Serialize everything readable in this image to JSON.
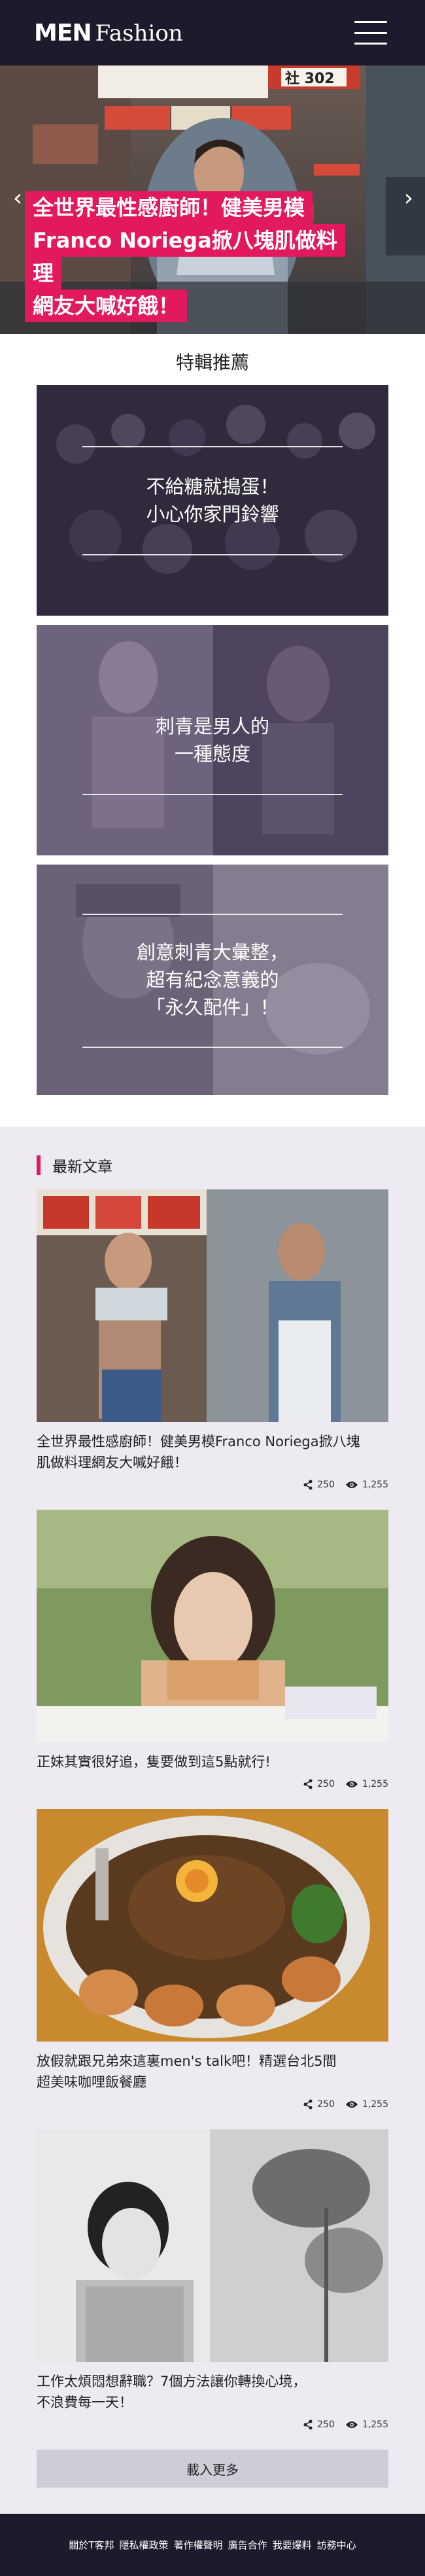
{
  "header": {
    "logo_men": "MEN",
    "logo_fashion": "Fashion",
    "menu_icon": "hamburger-menu-icon"
  },
  "hero": {
    "caption_lines": [
      "全世界最性感廚師！健美男模",
      "Franco Noriega掀八塊肌做料理",
      "網友大喊好餓！"
    ],
    "sign_text": "社 302",
    "prev_icon": "chevron-left-icon",
    "next_icon": "chevron-right-icon"
  },
  "featured": {
    "title": "特輯推薦",
    "items": [
      {
        "text": "不給糖就搗蛋！\n小心你家門鈴響"
      },
      {
        "text": "刺青是男人的\n一種態度"
      },
      {
        "text": "創意刺青大彙整，\n超有紀念意義的\n「永久配件」！"
      }
    ]
  },
  "latest": {
    "title": "最新文章",
    "articles": [
      {
        "title": "全世界最性感廚師！健美男模Franco Noriega掀八塊\n肌做料理網友大喊好餓！",
        "shares": "250",
        "views": "1,255"
      },
      {
        "title": "正妹其實很好追，隻要做到這5點就行!",
        "shares": "250",
        "views": "1,255"
      },
      {
        "title": "放假就跟兄弟來這裏men's talk吧！精選台北5間\n超美味咖哩飯餐廳",
        "shares": "250",
        "views": "1,255"
      },
      {
        "title": "工作太煩悶想辭職？7個方法讓你轉換心境，\n不浪費每一天！",
        "shares": "250",
        "views": "1,255"
      }
    ],
    "load_more": "載入更多"
  },
  "footer": {
    "links": [
      "關於T客邦",
      "隱私權政策",
      "著作權聲明",
      "廣告合作",
      "我要爆料",
      "訪務中心"
    ]
  },
  "colors": {
    "header_bg": "#1f1a2b",
    "accent": "#e3195e",
    "latest_bg": "#edeaf1",
    "button_bg": "#cfccd6"
  }
}
